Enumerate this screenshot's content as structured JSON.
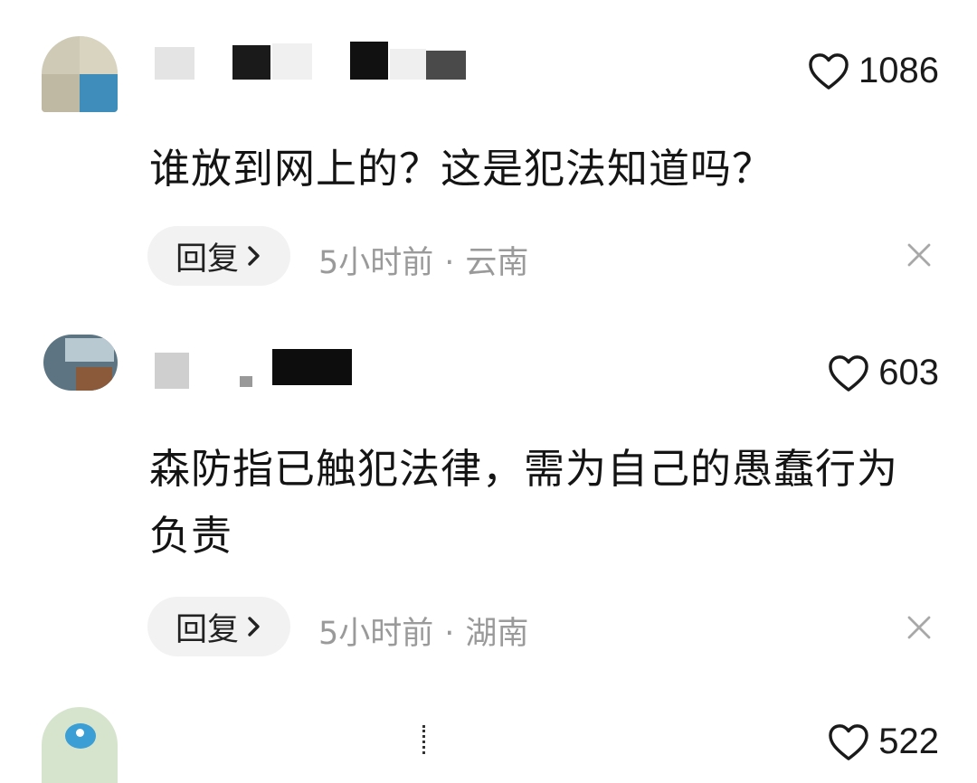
{
  "comments": [
    {
      "likes": "1086",
      "text": "谁放到网上的？这是犯法知道吗？",
      "reply_label": "回复",
      "time": "5小时前",
      "location": "云南"
    },
    {
      "likes": "603",
      "text": "森防指已触犯法律，需为自己的愚蠢行为负责",
      "reply_label": "回复",
      "time": "5小时前",
      "location": "湖南"
    },
    {
      "likes": "522"
    }
  ],
  "separator": "·",
  "icons": {
    "like": "heart-outline-icon",
    "reply_arrow": "chevron-right-icon",
    "dismiss": "close-icon"
  },
  "colors": {
    "meta_text": "#9a9a9a",
    "pill_bg": "#f2f2f2"
  }
}
